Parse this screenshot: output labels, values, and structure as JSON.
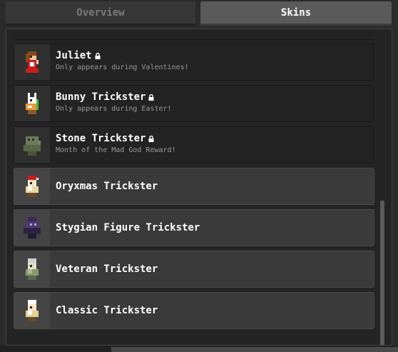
{
  "tabs": [
    {
      "label": "Overview",
      "active": false
    },
    {
      "label": "Skins",
      "active": true
    }
  ],
  "skins": [
    {
      "name": "Juliet",
      "description": "Only appears during Valentines!",
      "locked": true,
      "sprite": "juliet-sprite"
    },
    {
      "name": "Bunny Trickster",
      "description": "Only appears during Easter!",
      "locked": true,
      "sprite": "bunny-sprite"
    },
    {
      "name": "Stone Trickster",
      "description": "Month of the Mad God Reward!",
      "locked": true,
      "sprite": "stone-sprite"
    },
    {
      "name": "Oryxmas Trickster",
      "description": "",
      "locked": false,
      "sprite": "oryxmas-sprite"
    },
    {
      "name": "Stygian Figure Trickster",
      "description": "",
      "locked": false,
      "sprite": "stygian-sprite"
    },
    {
      "name": "Veteran Trickster",
      "description": "",
      "locked": false,
      "sprite": "veteran-sprite"
    },
    {
      "name": "Classic Trickster",
      "description": "",
      "locked": false,
      "sprite": "classic-sprite"
    }
  ],
  "colors": {
    "active_tab": "#5a5a5a",
    "inactive_tab": "#373737",
    "panel": "#242424",
    "unlocked_row": "#3a3a3a"
  }
}
